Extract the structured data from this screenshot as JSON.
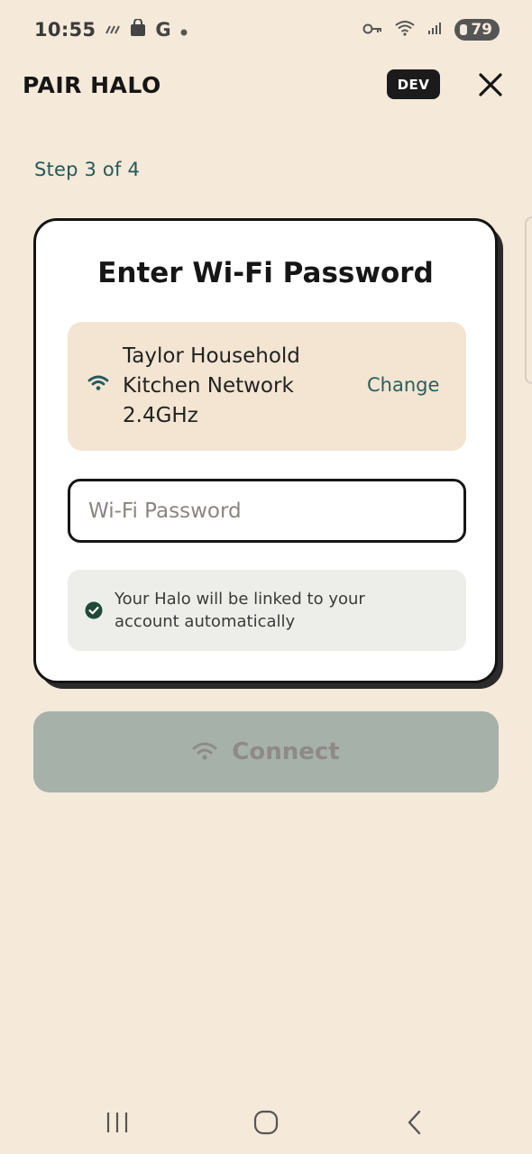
{
  "status_bar": {
    "time": "10:55",
    "left_icons": [
      "signal-activity-icon",
      "shopping-bag-icon",
      "google-icon",
      "dot-icon"
    ],
    "right_icons": [
      "vpn-key-icon",
      "wifi-icon",
      "cell-signal-icon"
    ],
    "battery": "79"
  },
  "header": {
    "title": "PAIR HALO",
    "badge": "DEV"
  },
  "step": "Step 3 of 4",
  "card": {
    "title": "Enter Wi-Fi Password",
    "network": {
      "name_line1": "Taylor Household",
      "name_line2": "Kitchen Network",
      "name_line3": "2.4GHz",
      "change_label": "Change"
    },
    "password": {
      "value": "",
      "placeholder": "Wi-Fi Password"
    },
    "info": "Your Halo will be linked to your account automatically"
  },
  "connect_label": "Connect",
  "colors": {
    "background": "#f5e9d9",
    "accent": "#24595a",
    "button_disabled": "#a6b1aa",
    "success": "#1f4a3a"
  }
}
